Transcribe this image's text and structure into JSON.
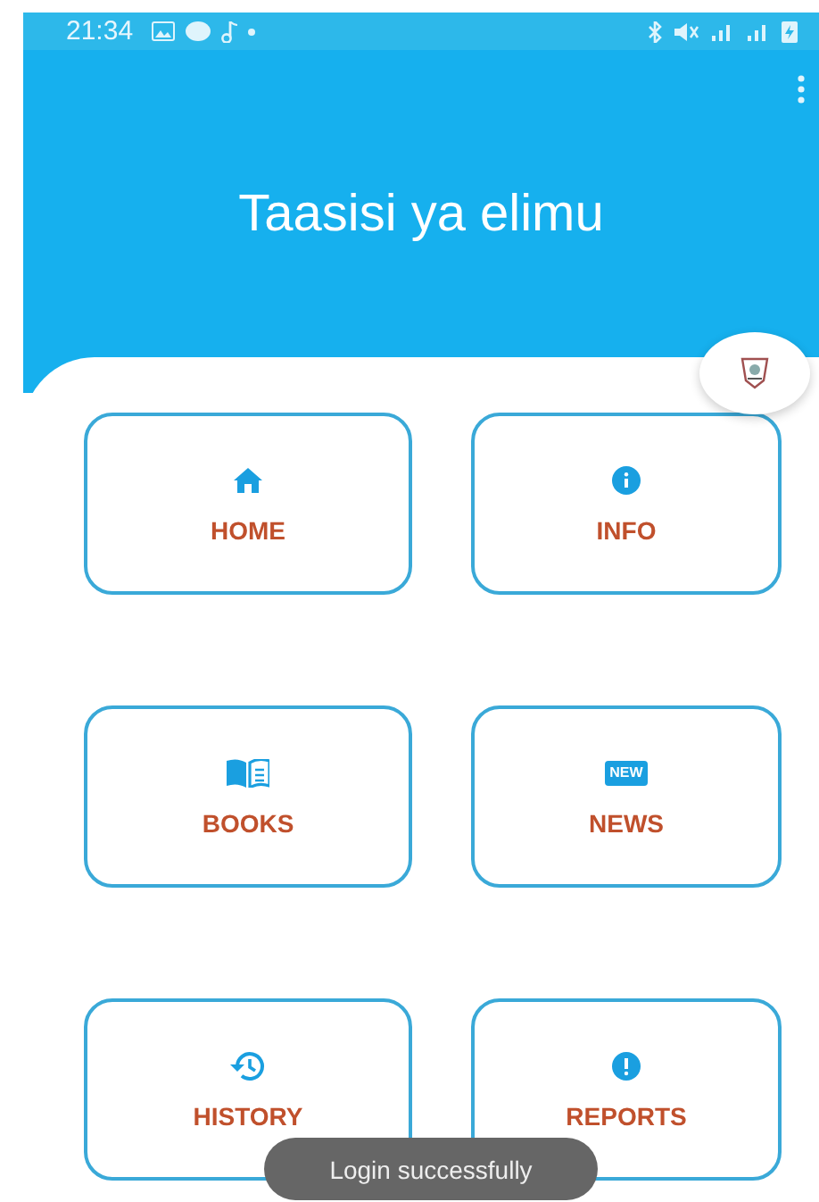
{
  "status_bar": {
    "time": "21:34"
  },
  "app_bar": {
    "title": "Taasisi ya elimu"
  },
  "menu_items": [
    {
      "label": "HOME",
      "kind": "home"
    },
    {
      "label": "INFO",
      "kind": "info"
    },
    {
      "label": "BOOKS",
      "kind": "books"
    },
    {
      "label": "NEWS",
      "kind": "news"
    },
    {
      "label": "HISTORY",
      "kind": "history"
    },
    {
      "label": "REPORTS",
      "kind": "reports"
    }
  ],
  "news_icon_text": "NEW",
  "toast": {
    "message": "Login successfully"
  }
}
